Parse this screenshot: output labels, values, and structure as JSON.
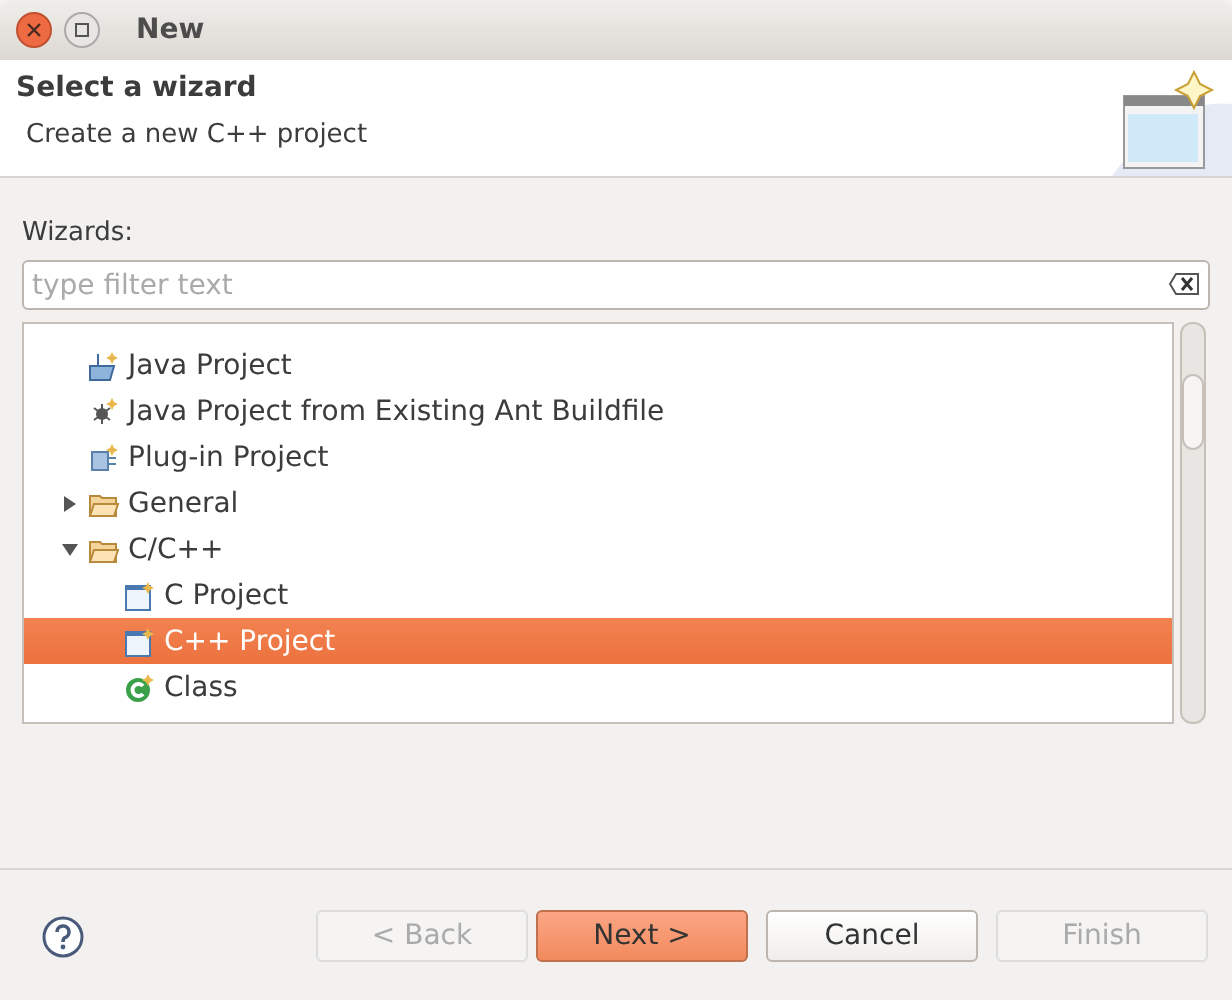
{
  "window": {
    "title": "New"
  },
  "header": {
    "title": "Select a wizard",
    "description": "Create a new C++ project"
  },
  "wizards_label": "Wizards:",
  "filter": {
    "placeholder": "type filter text"
  },
  "tree": [
    {
      "label": "Java Project",
      "kind": "java-project",
      "selected": false
    },
    {
      "label": "Java Project from Existing Ant Buildfile",
      "kind": "ant",
      "selected": false
    },
    {
      "label": "Plug-in Project",
      "kind": "plugin",
      "selected": false
    },
    {
      "label": "General",
      "kind": "folder",
      "expanded": false,
      "selected": false
    },
    {
      "label": "C/C++",
      "kind": "folder",
      "expanded": true,
      "selected": false,
      "children": [
        {
          "label": "C Project",
          "kind": "c-project",
          "selected": false
        },
        {
          "label": "C++ Project",
          "kind": "cpp-project",
          "selected": true
        },
        {
          "label": "Class",
          "kind": "class",
          "selected": false
        }
      ]
    }
  ],
  "buttons": [
    {
      "label": "< Back",
      "disabled": true,
      "default": false
    },
    {
      "label": "Next >",
      "disabled": false,
      "default": true
    },
    {
      "label": "Cancel",
      "disabled": false,
      "default": false
    },
    {
      "label": "Finish",
      "disabled": true,
      "default": false
    }
  ]
}
